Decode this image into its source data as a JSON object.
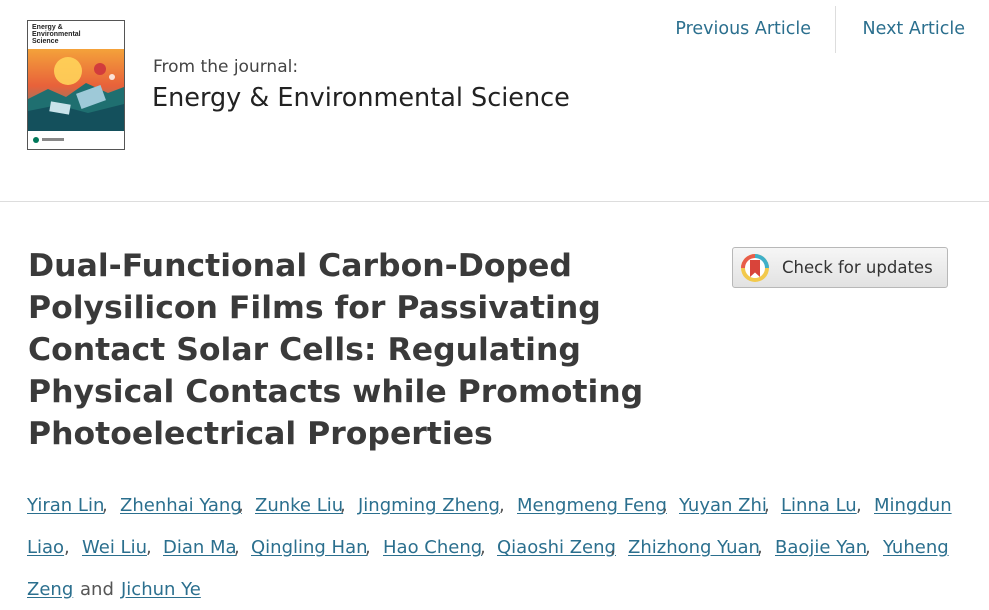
{
  "header": {
    "from_label": "From the journal:",
    "journal_name": "Energy & Environmental Science",
    "cover": {
      "title": "Energy & Environmental Science",
      "icon": "journal-cover-image"
    },
    "nav": {
      "previous": "Previous Article",
      "next": "Next Article"
    }
  },
  "article": {
    "title_lines": [
      "Dual-Functional Carbon-Doped",
      "Polysilicon Films for Passivating",
      "Contact Solar Cells: Regulating",
      "Physical Contacts while Promoting",
      "Photoelectrical Properties"
    ],
    "check_updates": {
      "label": "Check for updates",
      "icon": "crossmark-icon"
    },
    "authors": [
      "Yiran Lin",
      "Zhenhai Yang",
      "Zunke Liu",
      "Jingming Zheng",
      "Mengmeng Feng",
      "Yuyan Zhi",
      "Linna Lu",
      "Mingdun",
      "Liao",
      "Wei Liu",
      "Dian Ma",
      "Qingling Han",
      "Hao Cheng",
      "Qiaoshi Zeng",
      "Zhizhong Yuan",
      "Baojie Yan",
      "Yuheng",
      "Zeng",
      "Jichun Ye"
    ],
    "separator": ",",
    "conjunction": "and"
  },
  "colors": {
    "link": "#2b6f8e",
    "title": "#3a3a3a",
    "divider": "#dddddd"
  }
}
